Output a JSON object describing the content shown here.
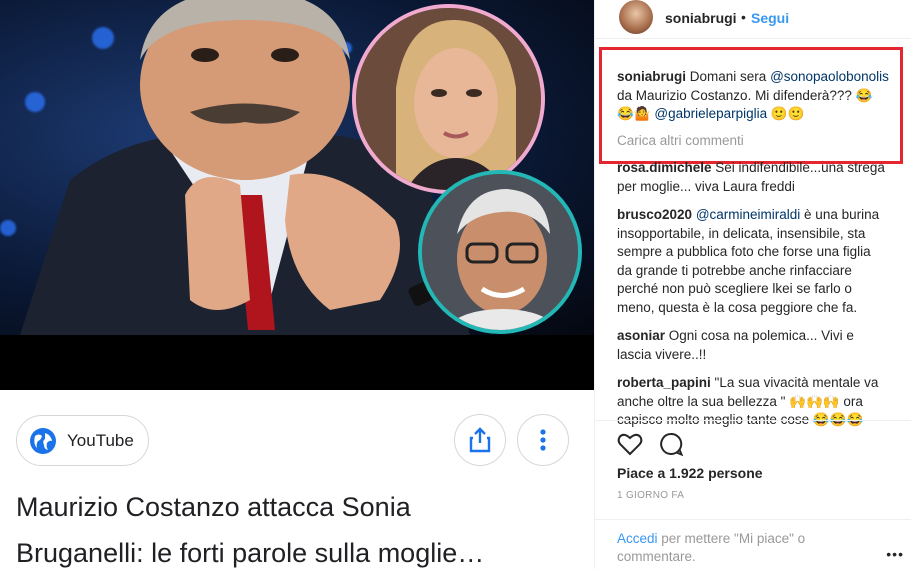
{
  "media": {
    "source_label": "YouTube",
    "headline_line1": "Maurizio Costanzo attacca Sonia",
    "headline_line2": "Bruganelli: le forti parole sulla moglie…"
  },
  "post": {
    "username": "soniabrugi",
    "separator": "•",
    "follow_label": "Segui",
    "caption": {
      "user": "soniabrugi",
      "text1": " Domani sera ",
      "mention1": "@sonopaolobonolis",
      "text2": " da Maurizio Costanzo. Mi difenderà??? 😂😂🤷 ",
      "mention2": "@gabrieleparpiglia",
      "text3": " 🙂🙂"
    },
    "load_more": "Carica altri commenti",
    "comments": [
      {
        "user": "rosa.dimichele",
        "text": " Sei indifendibile...una strega per moglie... viva Laura freddi"
      },
      {
        "user": "brusco2020",
        "mention": "@carmineimiraldi",
        "text": " è una burina insopportabile, in delicata, insensibile, sta sempre a pubblica foto che forse una figlia da grande ti potrebbe anche rinfacciare perché non può scegliere lkei se farlo o meno, questa è la cosa peggiore che fa."
      },
      {
        "user": "asoniar",
        "text": " Ogni cosa na polemica... Vivi e lascia vivere..!!"
      },
      {
        "user": "roberta_papini",
        "text": " \"La sua vivacità mentale va anche oltre la sua bellezza \" 🙌🙌🙌 ora capisco molto meglio tante cose 😂😂😂"
      }
    ],
    "likes_text": "Piace a 1.922 persone",
    "timestamp": "1 GIORNO FA",
    "add_comment": {
      "login_link": "Accedi",
      "rest": " per mettere \"Mi piace\" o commentare."
    },
    "more_dots": "•••"
  },
  "colors": {
    "link_blue": "#3897f0",
    "mention_blue": "#003569",
    "highlight_red": "#e5252f",
    "pink_ring": "#f0a9cf",
    "teal_ring": "#23b7b6"
  },
  "icons": [
    "globe-icon",
    "share-icon",
    "more-vert-icon",
    "heart-icon",
    "comment-icon"
  ]
}
